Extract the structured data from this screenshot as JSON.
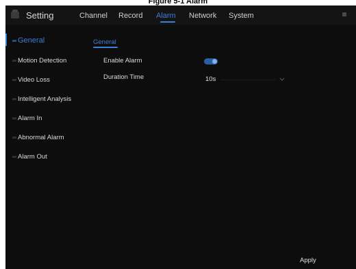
{
  "caption": "Figure 5-1 Alarm",
  "header": {
    "title": "Setting",
    "tabs": [
      {
        "label": "Channel"
      },
      {
        "label": "Record"
      },
      {
        "label": "Alarm",
        "active": true
      },
      {
        "label": "Network"
      },
      {
        "label": "System"
      }
    ]
  },
  "sidebar": {
    "items": [
      {
        "label": "General",
        "active": true
      },
      {
        "label": "Motion Detection"
      },
      {
        "label": "Video Loss"
      },
      {
        "label": "Intelligent Analysis"
      },
      {
        "label": "Alarm In"
      },
      {
        "label": "Abnormal Alarm"
      },
      {
        "label": "Alarm  Out"
      }
    ]
  },
  "content": {
    "subtab": "General",
    "enable_alarm": {
      "label": "Enable Alarm",
      "state": "on"
    },
    "duration_time": {
      "label": "Duration Time",
      "value": "10s"
    }
  },
  "footer": {
    "apply_label": "Apply"
  },
  "colors": {
    "accent": "#3d7fd3",
    "background": "#0d0d0d",
    "text": "#dcdcdc"
  }
}
